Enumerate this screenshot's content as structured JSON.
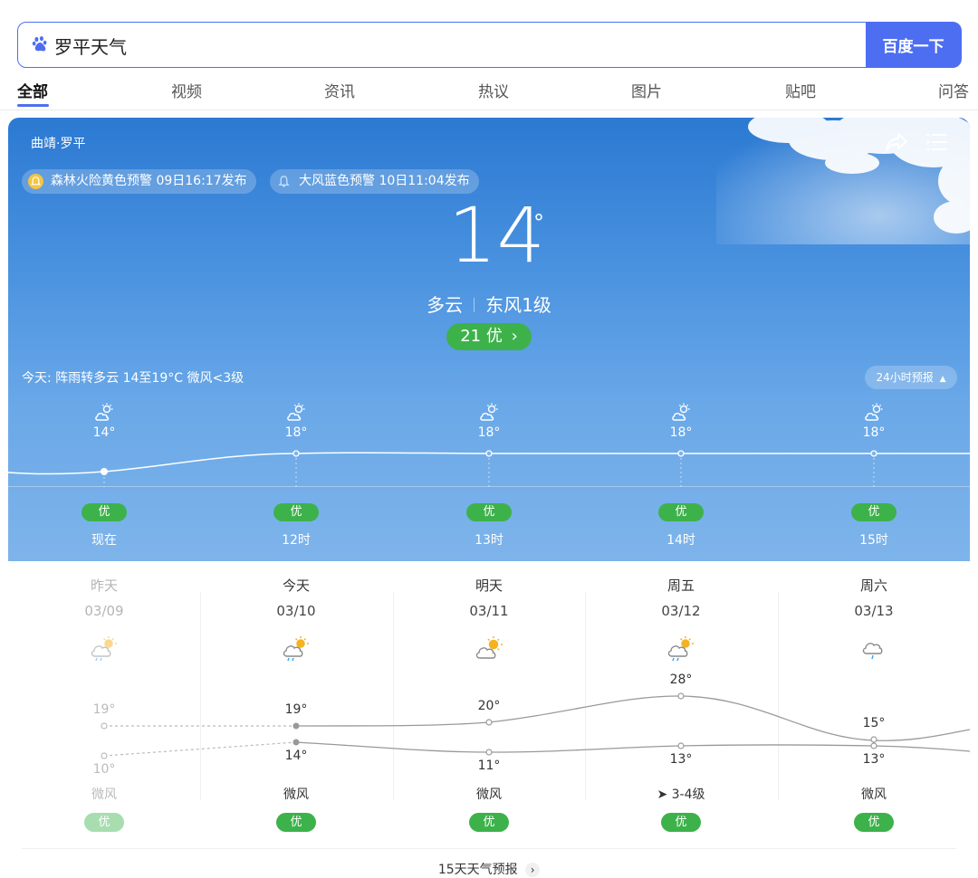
{
  "search": {
    "query": "罗平天气",
    "button": "百度一下"
  },
  "tabs": [
    "全部",
    "视频",
    "资讯",
    "热议",
    "图片",
    "贴吧",
    "问答"
  ],
  "weather": {
    "region": "曲靖·罗平",
    "alerts": [
      {
        "text": "森林火险黄色预警  09日16:17发布",
        "color": "#f4c542"
      },
      {
        "text": "大风蓝色预警  10日11:04发布",
        "color": "#5aa9f0"
      }
    ],
    "temp": "14",
    "degree": "°",
    "condition": "多云",
    "wind": "东风1级",
    "aqi": "21 优",
    "today_summary": "今天: 阵雨转多云  14至19°C  微风<3级",
    "forecast_24h": "24小时预报"
  },
  "hourly": [
    {
      "time": "现在",
      "temp": "14°",
      "aqi": "优"
    },
    {
      "time": "12时",
      "temp": "18°",
      "aqi": "优"
    },
    {
      "time": "13时",
      "temp": "18°",
      "aqi": "优"
    },
    {
      "time": "14时",
      "temp": "18°",
      "aqi": "优"
    },
    {
      "time": "15时",
      "temp": "18°",
      "aqi": "优"
    }
  ],
  "daily": [
    {
      "name": "昨天",
      "date": "03/09",
      "high": "19°",
      "low": "10°",
      "wind": "微风",
      "aqi": "优",
      "icon": "partly-rain-icon"
    },
    {
      "name": "今天",
      "date": "03/10",
      "high": "19°",
      "low": "14°",
      "wind": "微风",
      "aqi": "优",
      "icon": "partly-rain-icon"
    },
    {
      "name": "明天",
      "date": "03/11",
      "high": "20°",
      "low": "11°",
      "wind": "微风",
      "aqi": "优",
      "icon": "partly-cloudy-icon"
    },
    {
      "name": "周五",
      "date": "03/12",
      "high": "28°",
      "low": "13°",
      "wind": "➤ 3-4级",
      "aqi": "优",
      "icon": "partly-rain-icon"
    },
    {
      "name": "周六",
      "date": "03/13",
      "high": "15°",
      "low": "13°",
      "wind": "微风",
      "aqi": "优",
      "icon": "rain-icon"
    }
  ],
  "more_link": "15天天气预报"
}
